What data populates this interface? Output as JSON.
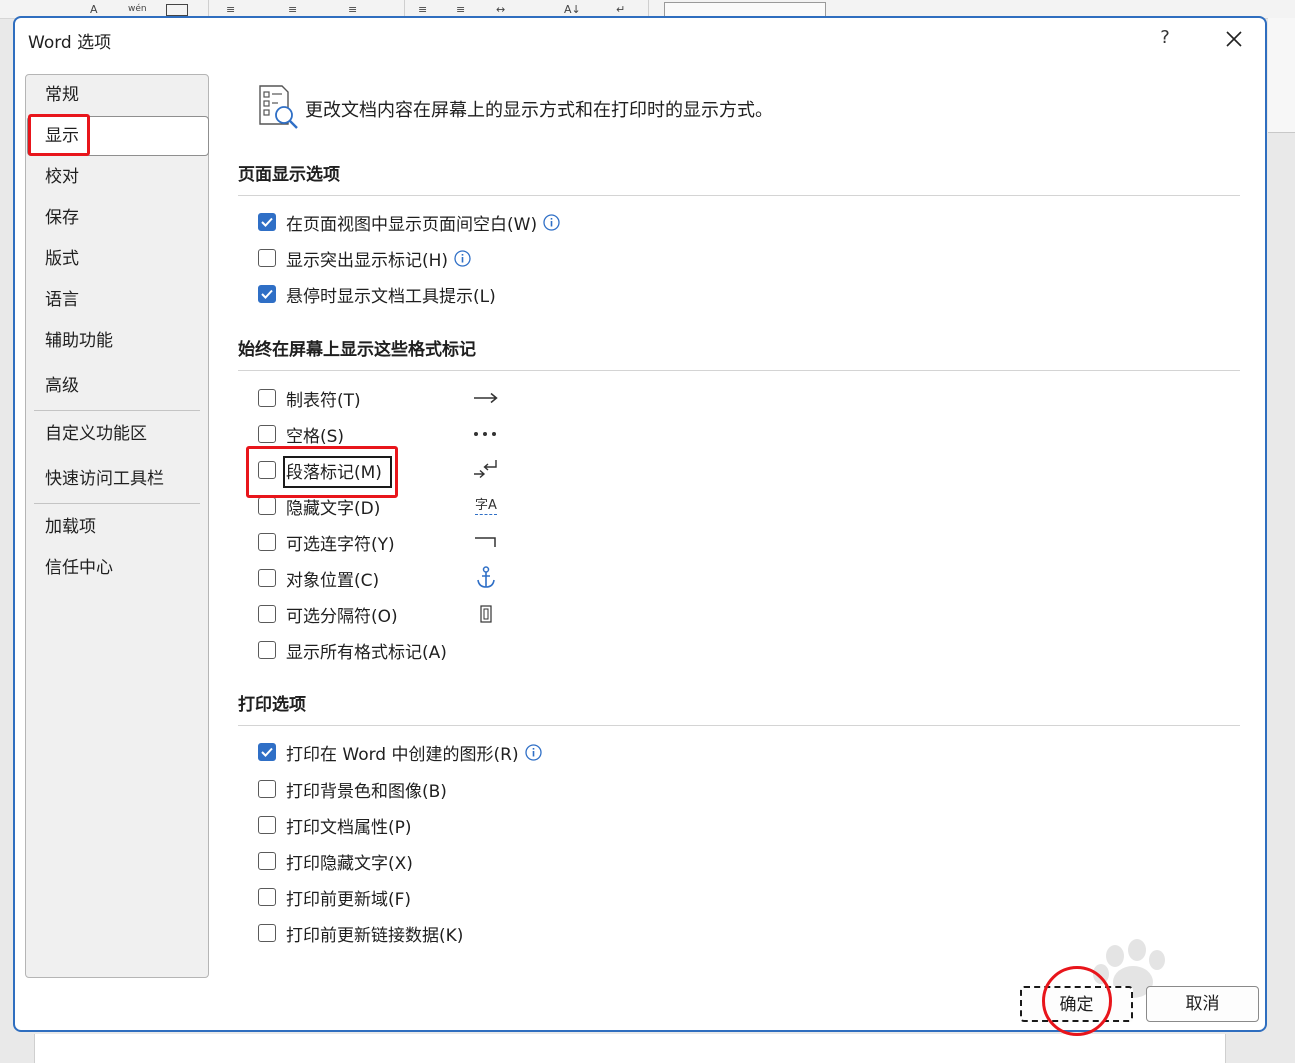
{
  "dialog": {
    "title": "Word 选项",
    "help": "?",
    "close_icon": "close-icon"
  },
  "nav": {
    "items": [
      "常规",
      "显示",
      "校对",
      "保存",
      "版式",
      "语言",
      "辅助功能",
      "高级",
      "自定义功能区",
      "快速访问工具栏",
      "加载项",
      "信任中心"
    ],
    "selected": "显示"
  },
  "header": {
    "text": "更改文档内容在屏幕上的显示方式和在打印时的显示方式。",
    "icon": "display-options-icon"
  },
  "sections": {
    "page_display": {
      "title": "页面显示选项",
      "options": [
        {
          "label": "在页面视图中显示页面间空白(W)",
          "checked": true,
          "info": true
        },
        {
          "label": "显示突出显示标记(H)",
          "checked": false,
          "info": true
        },
        {
          "label": "悬停时显示文档工具提示(L)",
          "checked": true,
          "info": false
        }
      ]
    },
    "format_marks": {
      "title": "始终在屏幕上显示这些格式标记",
      "options": [
        {
          "label": "制表符(T)",
          "checked": false,
          "symbol": "arrow-right-icon"
        },
        {
          "label": "空格(S)",
          "checked": false,
          "symbol": "dots-icon"
        },
        {
          "label": "段落标记(M)",
          "checked": false,
          "symbol": "paragraph-mark-icon"
        },
        {
          "label": "隐藏文字(D)",
          "checked": false,
          "symbol": "hidden-text-icon",
          "symbol_text": "字A"
        },
        {
          "label": "可选连字符(Y)",
          "checked": false,
          "symbol": "optional-hyphen-icon"
        },
        {
          "label": "对象位置(C)",
          "checked": false,
          "symbol": "anchor-icon"
        },
        {
          "label": "可选分隔符(O)",
          "checked": false,
          "symbol": "optional-break-icon"
        },
        {
          "label": "显示所有格式标记(A)",
          "checked": false
        }
      ]
    },
    "print": {
      "title": "打印选项",
      "options": [
        {
          "label": "打印在 Word 中创建的图形(R)",
          "checked": true,
          "info": true
        },
        {
          "label": "打印背景色和图像(B)",
          "checked": false
        },
        {
          "label": "打印文档属性(P)",
          "checked": false
        },
        {
          "label": "打印隐藏文字(X)",
          "checked": false
        },
        {
          "label": "打印前更新域(F)",
          "checked": false
        },
        {
          "label": "打印前更新链接数据(K)",
          "checked": false
        }
      ]
    }
  },
  "buttons": {
    "ok": "确定",
    "cancel": "取消"
  },
  "ribbon": {
    "phonetic": "wén"
  },
  "colors": {
    "accent": "#2f6fc6",
    "highlight": "#e8151b",
    "dialog_border": "#2f6ebf"
  }
}
